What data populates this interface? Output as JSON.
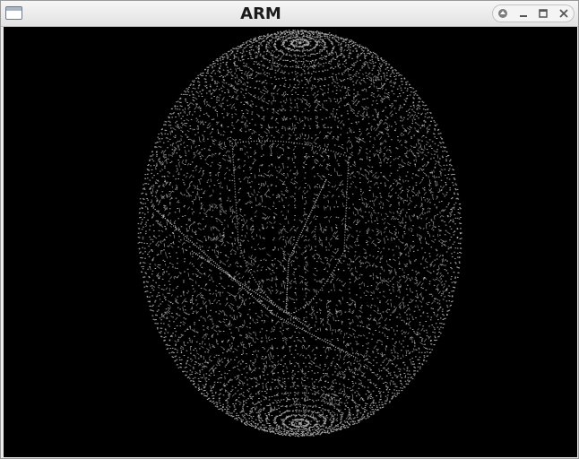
{
  "window": {
    "title": "ARM",
    "controls": [
      "shade-icon",
      "minimize-icon",
      "maximize-icon",
      "close-icon"
    ]
  },
  "canvas": {
    "background": "#000000",
    "point_color": "#dcdcdc",
    "content": "point-cloud-ellipsoid"
  }
}
